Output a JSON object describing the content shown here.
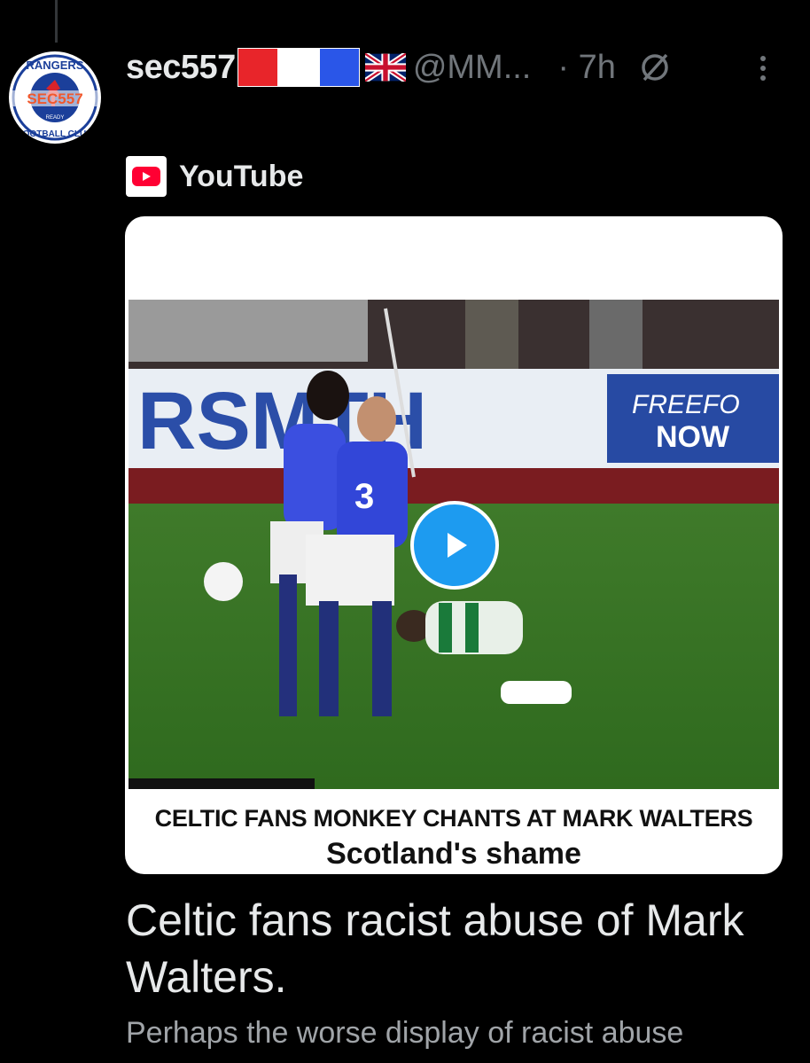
{
  "post": {
    "avatar_text_top": "RANGERS",
    "avatar_text_mid": "SEC557",
    "avatar_text_small": "READY",
    "avatar_text_bottom": "FOOTBALL CLUB",
    "display_name": "sec557",
    "handle": "@MM...",
    "time": "· 7h",
    "flag_colors": [
      "#e8252a",
      "#ffffff",
      "#2a56e8"
    ]
  },
  "link": {
    "source_label": "YouTube",
    "video": {
      "ad_text_left": "RSMTH",
      "ad_text_right_1": "FREEFO",
      "ad_text_right_2": "NOW",
      "player_number": "3",
      "caption_line1": "CELTIC FANS MONKEY CHANTS AT MARK WALTERS",
      "caption_line2": "Scotland's shame"
    },
    "title": "Celtic fans racist abuse of Mark Walters.",
    "description": "Perhaps the worse display of racist abuse"
  },
  "icons": [
    "grok-icon",
    "more-icon",
    "youtube-icon",
    "play-icon",
    "uk-flag-icon"
  ],
  "colors": {
    "background": "#000000",
    "accent": "#1d9bf0",
    "muted": "#71767b"
  }
}
